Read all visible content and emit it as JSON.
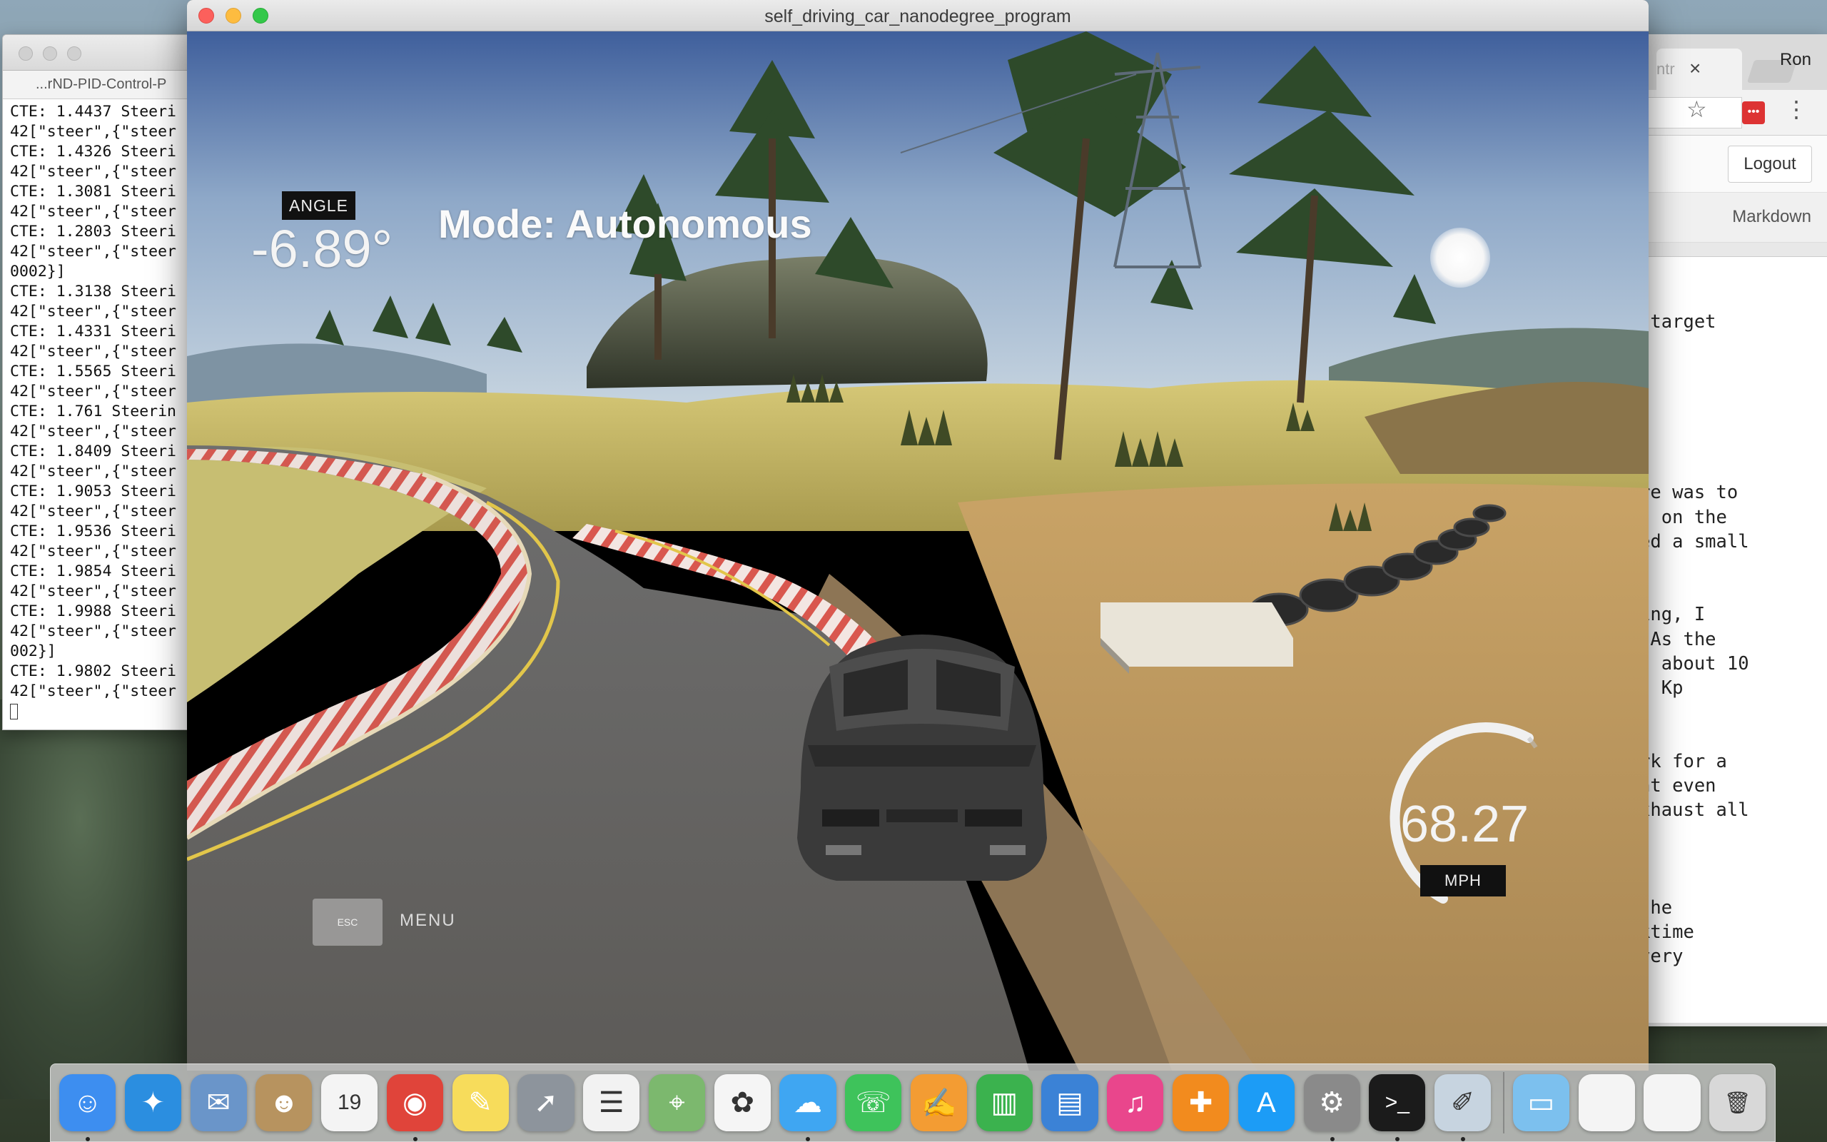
{
  "terminal": {
    "tab_title": "...rND-PID-Control-P",
    "lines": [
      "CTE: 1.4437 Steeri",
      "42[\"steer\",{\"steer",
      "CTE: 1.4326 Steeri",
      "42[\"steer\",{\"steer",
      "CTE: 1.3081 Steeri",
      "42[\"steer\",{\"steer",
      "CTE: 1.2803 Steeri",
      "42[\"steer\",{\"steer",
      "0002}]",
      "CTE: 1.3138 Steeri",
      "42[\"steer\",{\"steer",
      "CTE: 1.4331 Steeri",
      "42[\"steer\",{\"steer",
      "CTE: 1.5565 Steeri",
      "42[\"steer\",{\"steer",
      "CTE: 1.761 Steerin",
      "42[\"steer\",{\"steer",
      "CTE: 1.8409 Steeri",
      "42[\"steer\",{\"steer",
      "CTE: 1.9053 Steeri",
      "42[\"steer\",{\"steer",
      "CTE: 1.9536 Steeri",
      "42[\"steer\",{\"steer",
      "CTE: 1.9854 Steeri",
      "42[\"steer\",{\"steer",
      "CTE: 1.9988 Steeri",
      "42[\"steer\",{\"steer",
      "002}]",
      "CTE: 1.9802 Steeri",
      "42[\"steer\",{\"steer"
    ]
  },
  "browser": {
    "tab_label": "ntr",
    "tab_close": "×",
    "user": "Ron",
    "logout_label": "Logout",
    "markdown_label": "Markdown",
    "editor_text": "the target\n\n\n\n\n\n\nedure was to\nhoot on the\nluded a small\n\n\norking, I\ned. As the\n was about 10\nimes Kp\n\n\n work for a\n that even\nt exhaust all\n\n\n\nin the\nuicktime\nrm very"
  },
  "simulator": {
    "window_title": "self_driving_car_nanodegree_program",
    "angle_label": "ANGLE",
    "angle_value": "-6.89°",
    "mode_text": "Mode: Autonomous",
    "esc_label": "ESC",
    "menu_label": "MENU",
    "speed_value": "68.27",
    "speed_unit": "MPH",
    "speed_fraction": 0.68
  },
  "dock": {
    "apps": [
      {
        "name": "finder-icon",
        "glyph": "☺",
        "color": "#3d8ef0",
        "running": true
      },
      {
        "name": "safari-icon",
        "glyph": "✦",
        "color": "#2b8ee0",
        "running": false
      },
      {
        "name": "mail-icon",
        "glyph": "✉",
        "color": "#6a95c9",
        "running": false
      },
      {
        "name": "contacts-icon",
        "glyph": "☻",
        "color": "#b7935f",
        "running": false
      },
      {
        "name": "calendar-icon",
        "glyph": "19",
        "color": "#f4f4f4",
        "running": false
      },
      {
        "name": "chrome-icon",
        "glyph": "◉",
        "color": "#e0443a",
        "running": true
      },
      {
        "name": "notes-icon",
        "glyph": "✎",
        "color": "#f7dc5b",
        "running": false
      },
      {
        "name": "launchpad-icon",
        "glyph": "➚",
        "color": "#8d949c",
        "running": false
      },
      {
        "name": "reminders-icon",
        "glyph": "☰",
        "color": "#f2f2f2",
        "running": false
      },
      {
        "name": "maps-icon",
        "glyph": "⌖",
        "color": "#7cb86e",
        "running": false
      },
      {
        "name": "photos-icon",
        "glyph": "✿",
        "color": "#f5f5f5",
        "running": false
      },
      {
        "name": "messages-icon",
        "glyph": "☁",
        "color": "#3fa6f2",
        "running": true
      },
      {
        "name": "facetime-icon",
        "glyph": "☏",
        "color": "#3ec35b",
        "running": false
      },
      {
        "name": "pages-icon",
        "glyph": "✍",
        "color": "#f39c33",
        "running": false
      },
      {
        "name": "numbers-icon",
        "glyph": "▥",
        "color": "#3bb24e",
        "running": false
      },
      {
        "name": "keynote-icon",
        "glyph": "▤",
        "color": "#3b82d6",
        "running": false
      },
      {
        "name": "itunes-icon",
        "glyph": "♫",
        "color": "#e9468c",
        "running": false
      },
      {
        "name": "ibooks-icon",
        "glyph": "✚",
        "color": "#f28b1e",
        "running": false
      },
      {
        "name": "app-store-icon",
        "glyph": "A",
        "color": "#1c9cf6",
        "running": false
      },
      {
        "name": "system-preferences-icon",
        "glyph": "⚙",
        "color": "#8a8a8a",
        "running": true
      },
      {
        "name": "terminal-icon",
        "glyph": ">_",
        "color": "#1b1b1b",
        "running": true
      },
      {
        "name": "preview-icon",
        "glyph": "✐",
        "color": "#c7d4e0",
        "running": true
      }
    ],
    "right_items": [
      {
        "name": "downloads-folder-icon",
        "glyph": "▭",
        "color": "#7cc0ee"
      },
      {
        "name": "chrome-window-thumbnail-1",
        "glyph": "",
        "color": "#f4f4f4"
      },
      {
        "name": "chrome-window-thumbnail-2",
        "glyph": "",
        "color": "#f4f4f4"
      },
      {
        "name": "trash-icon",
        "glyph": "🗑",
        "color": "#d8d8d8"
      }
    ]
  }
}
